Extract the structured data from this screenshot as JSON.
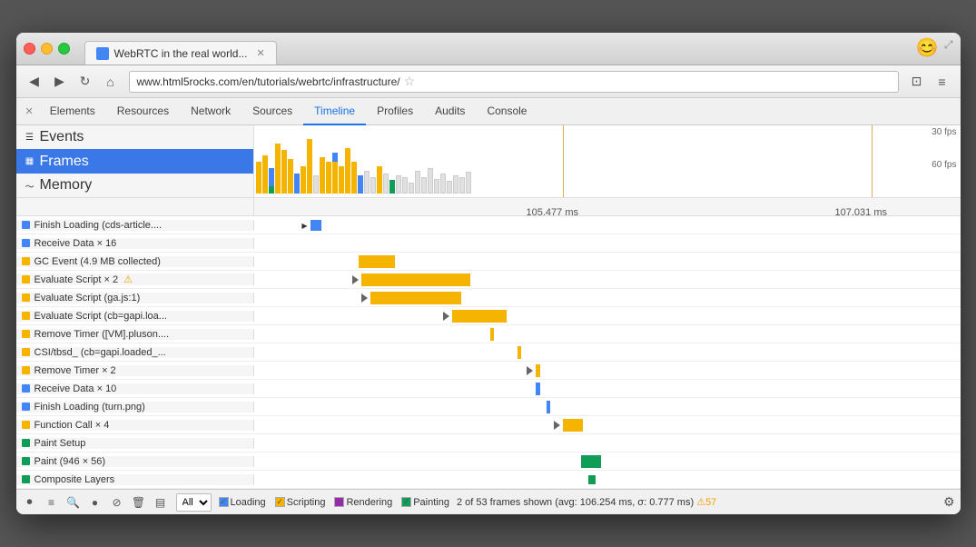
{
  "browser": {
    "title": "WebRTC in the real world...",
    "url": "www.html5rocks.com/en/tutorials/webrtc/infrastructure/",
    "emoji": "😊"
  },
  "devtools": {
    "tabs": [
      "Elements",
      "Resources",
      "Network",
      "Sources",
      "Timeline",
      "Profiles",
      "Audits",
      "Console"
    ],
    "active_tab": "Timeline"
  },
  "timeline": {
    "left_panel": {
      "items": [
        {
          "id": "events",
          "label": "Events",
          "icon": "≡",
          "color": null,
          "active": false
        },
        {
          "id": "frames",
          "label": "Frames",
          "icon": "▦",
          "color": null,
          "active": true
        },
        {
          "id": "memory",
          "label": "Memory",
          "icon": "~",
          "color": null,
          "active": false
        }
      ]
    },
    "fps_labels": [
      "30 fps",
      "60 fps"
    ],
    "time_markers": [
      "105.477 ms",
      "107.031 ms"
    ],
    "events": [
      {
        "color": "#4285f4",
        "label": "Finish Loading (cds-article...."
      },
      {
        "color": "#4285f4",
        "label": "Receive Data × 16"
      },
      {
        "color": "#f4b400",
        "label": "GC Event (4.9 MB collected)"
      },
      {
        "color": "#f4b400",
        "label": "Evaluate Script × 2",
        "warning": true
      },
      {
        "color": "#f4b400",
        "label": "Evaluate Script (ga.js:1)"
      },
      {
        "color": "#f4b400",
        "label": "Evaluate Script (cb=gapi.loa..."
      },
      {
        "color": "#f4b400",
        "label": "Remove Timer ([VM].pluson...."
      },
      {
        "color": "#f4b400",
        "label": "CSI/tbsd_ (cb=gapi.loaded_..."
      },
      {
        "color": "#f4b400",
        "label": "Remove Timer × 2"
      },
      {
        "color": "#4285f4",
        "label": "Receive Data × 10"
      },
      {
        "color": "#4285f4",
        "label": "Finish Loading (turn.png)"
      },
      {
        "color": "#f4b400",
        "label": "Function Call × 4"
      },
      {
        "color": "#0f9d58",
        "label": "Paint Setup"
      },
      {
        "color": "#0f9d58",
        "label": "Paint (946 × 56)"
      },
      {
        "color": "#0f9d58",
        "label": "Composite Layers"
      }
    ]
  },
  "bottom_bar": {
    "filter": "All",
    "checkboxes": [
      {
        "label": "Loading",
        "checked": true,
        "color": "#4285f4"
      },
      {
        "label": "Scripting",
        "checked": true,
        "color": "#f4b400"
      },
      {
        "label": "Rendering",
        "checked": true,
        "color": "#9c27b0"
      },
      {
        "label": "Painting",
        "checked": true,
        "color": "#0f9d58"
      }
    ],
    "status": "2 of 53 frames shown (avg: 106.254 ms, σ: 0.777 ms)",
    "warning_count": "57"
  }
}
